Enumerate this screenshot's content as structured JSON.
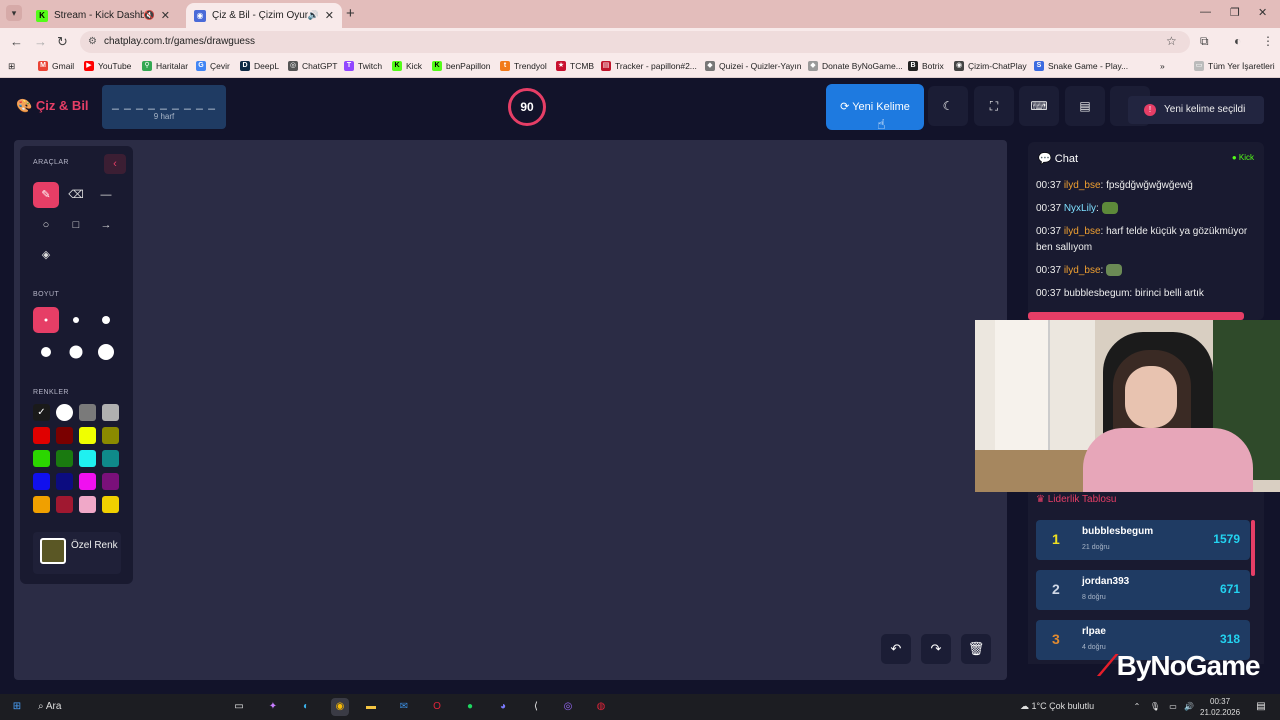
{
  "browser": {
    "tabs": [
      {
        "title": "Stream - Kick Dashboard"
      },
      {
        "title": "Çiz & Bil - Çizim Oyunu"
      }
    ],
    "url": "chatplay.com.tr/games/drawguess",
    "bookmarks": [
      "Gmail",
      "YouTube",
      "Haritalar",
      "Çevir",
      "DeepL",
      "ChatGPT",
      "Twitch",
      "Kick",
      "benPapillon",
      "Trendyol",
      "TCMB",
      "Tracker - papillon#2...",
      "Quizei - Quizler-Yayın",
      "Donate ByNoGame...",
      "Botrix",
      "Çizim-ChatPlay",
      "Snake Game - Play...",
      "Tüm Yer İşaretleri"
    ]
  },
  "header": {
    "logo": "Çiz & Bil",
    "word_mask": "_ _ _ _ _ _ _ _ _",
    "letter_count": "9 harf",
    "timer": "90",
    "new_word_label": "Yeni Kelime",
    "toast": "Yeni kelime seçildi"
  },
  "tools": {
    "tools_title": "ARAÇLAR",
    "size_title": "BOYUT",
    "colors_title": "RENKLER",
    "custom_color_label": "Özel Renk",
    "colors": [
      "#1a1a1a",
      "#ffffff",
      "#7a7a7a",
      "#b0b0b0",
      "#e00000",
      "#7a0000",
      "#f0ff00",
      "#8a8a00",
      "#2bd600",
      "#1a7a10",
      "#1ff0f0",
      "#0f8a8a",
      "#1010ee",
      "#0c0c80",
      "#f010f0",
      "#7a107a",
      "#f0a000",
      "#a01830",
      "#f0a8c8",
      "#f0d000"
    ]
  },
  "chat": {
    "title": "Chat",
    "platform": "Kick",
    "messages": [
      {
        "time": "00:37",
        "user": "ilyd_bse",
        "text": "fpsğdğwğwğwğewğ"
      },
      {
        "time": "00:37",
        "user": "NyxLily",
        "text": ""
      },
      {
        "time": "00:37",
        "user": "ilyd_bse",
        "text": "harf telde küçük ya gözükmüyor ben sallıyom"
      },
      {
        "time": "00:37",
        "user": "ilyd_bse",
        "text": ""
      },
      {
        "time": "00:37",
        "user": "bubblesbegum",
        "text": "birinci belli artık"
      }
    ]
  },
  "leaderboard": {
    "title": "Liderlik Tablosu",
    "rows": [
      {
        "rank": "1",
        "name": "bubblesbegum",
        "sub": "21 doğru",
        "score": "1579"
      },
      {
        "rank": "2",
        "name": "jordan393",
        "sub": "8 doğru",
        "score": "671"
      },
      {
        "rank": "3",
        "name": "rlpae",
        "sub": "4 doğru",
        "score": "318"
      }
    ]
  },
  "watermark": "ByNoGame",
  "taskbar": {
    "search": "Ara",
    "weather": "1°C  Çok bulutlu",
    "time": "00:37",
    "date": "21.02.2026"
  }
}
